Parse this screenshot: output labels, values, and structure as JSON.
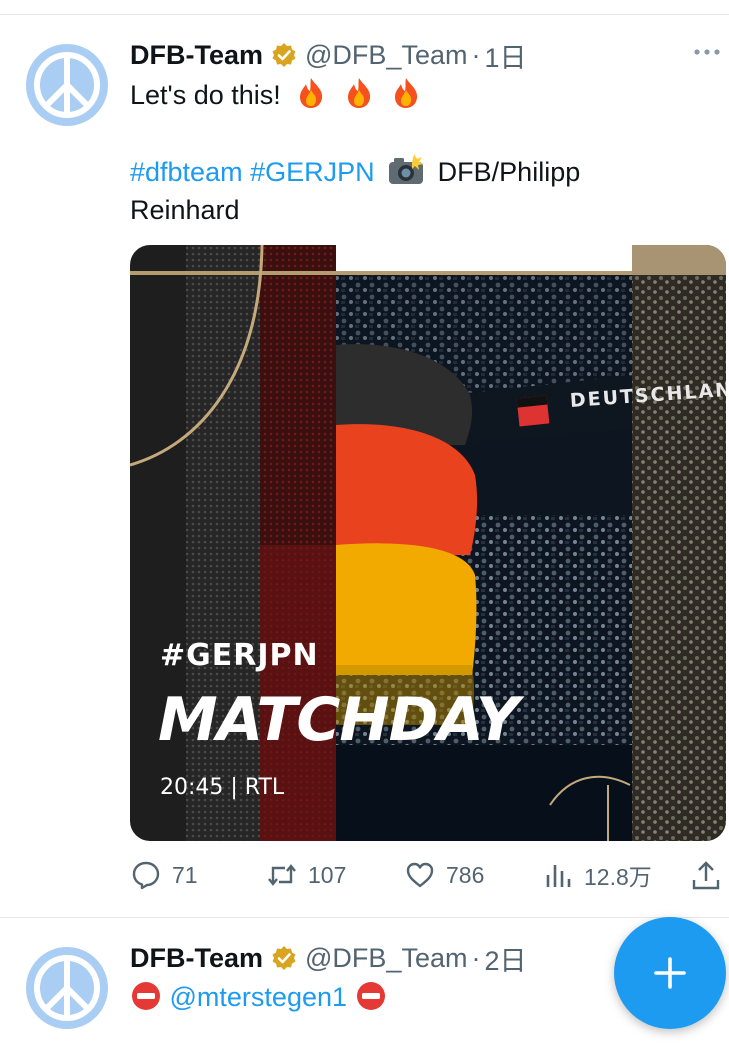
{
  "tweets": [
    {
      "name": "DFB-Team",
      "handle": "@DFB_Team",
      "dot": "·",
      "time": "1日",
      "line1": "Let's do this!",
      "hashtag1": "#dfbteam",
      "hashtag2": "#GERJPN",
      "credit1": "DFB/Philipp",
      "credit2": "Reinhard",
      "media": {
        "hashtag": "#GERJPN",
        "title": "MATCHDAY",
        "kickoff": "20:45 | RTL",
        "banner": "DEUTSCHLAND"
      },
      "stats": {
        "replies": "71",
        "retweets": "107",
        "likes": "786",
        "views": "12.8万"
      }
    },
    {
      "name": "DFB-Team",
      "handle": "@DFB_Team",
      "dot": "·",
      "time": "2日",
      "mention": "@mterstegen1"
    }
  ],
  "icons": {
    "avatar": "peace-sign-icon",
    "badge": "verified-gold-badge-icon",
    "more": "more-dots-icon",
    "reply": "reply-icon",
    "retweet": "retweet-icon",
    "like": "heart-icon",
    "views": "views-chart-icon",
    "share": "share-icon",
    "compose": "plus-icon"
  },
  "colors": {
    "link": "#1d9bf0",
    "secondary": "#536471",
    "avatar_bg": "#a9cdf3",
    "fab": "#1d9bf0",
    "badge": "#d9a520"
  }
}
